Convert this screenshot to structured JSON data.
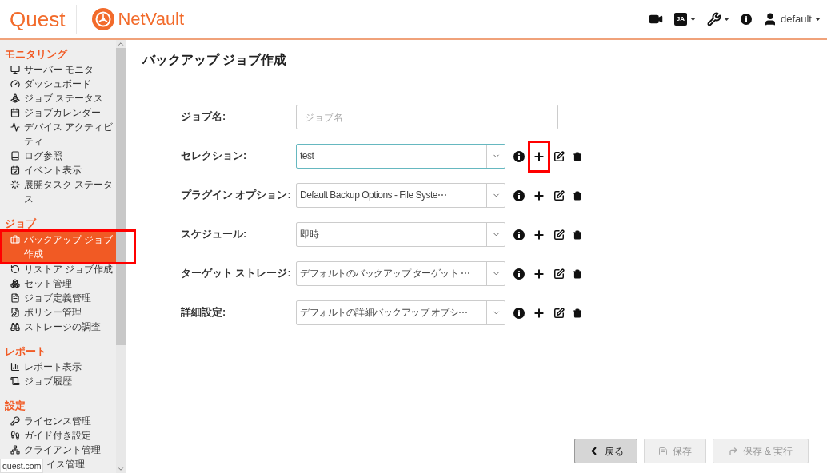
{
  "header": {
    "brand": "Quest",
    "product": "NetVault",
    "language": "JA",
    "user": "default"
  },
  "sidebar": {
    "sections": [
      {
        "title": "モニタリング",
        "items": [
          {
            "label": "サーバー モニタ",
            "selected": false
          },
          {
            "label": "ダッシュボード",
            "selected": false
          },
          {
            "label": "ジョブ ステータス",
            "selected": false
          },
          {
            "label": "ジョブカレンダー",
            "selected": false
          },
          {
            "label": "デバイス アクティビティ",
            "selected": false
          },
          {
            "label": "ログ参照",
            "selected": false
          },
          {
            "label": "イベント表示",
            "selected": false
          },
          {
            "label": "展開タスク ステータス",
            "selected": false
          }
        ]
      },
      {
        "title": "ジョブ",
        "items": [
          {
            "label": "バックアップ ジョブ作成",
            "selected": true,
            "highlighted": true
          },
          {
            "label": "リストア ジョブ作成",
            "selected": false
          },
          {
            "label": "セット管理",
            "selected": false
          },
          {
            "label": "ジョブ定義管理",
            "selected": false
          },
          {
            "label": "ポリシー管理",
            "selected": false
          },
          {
            "label": "ストレージの調査",
            "selected": false
          }
        ]
      },
      {
        "title": "レポート",
        "items": [
          {
            "label": "レポート表示",
            "selected": false
          },
          {
            "label": "ジョブ履歴",
            "selected": false
          }
        ]
      },
      {
        "title": "設定",
        "items": [
          {
            "label": "ライセンス管理",
            "selected": false
          },
          {
            "label": "ガイド付き設定",
            "selected": false
          },
          {
            "label": "クライアント管理",
            "selected": false
          },
          {
            "label": "イス管理",
            "selected": false,
            "covered": true
          }
        ]
      }
    ]
  },
  "status_tip": "quest.com",
  "page": {
    "title": "バックアップ ジョブ作成",
    "fields": [
      {
        "kind": "text",
        "label": "ジョブ名:",
        "placeholder": "ジョブ名"
      },
      {
        "kind": "select",
        "label": "セレクション:",
        "value": "test",
        "focused": true,
        "highlighted": true
      },
      {
        "kind": "select",
        "label": "プラグイン オプション:",
        "value": "Default Backup Options - File Syste⋯",
        "focused": false
      },
      {
        "kind": "select",
        "label": "スケジュール:",
        "value": "即時",
        "focused": false
      },
      {
        "kind": "select",
        "label": "ターゲット ストレージ:",
        "value": "デフォルトのバックアップ ターゲット ⋯",
        "focused": false
      },
      {
        "kind": "select",
        "label": "詳細設定:",
        "value": "デフォルトの詳細バックアップ オプシ⋯",
        "focused": false
      }
    ]
  },
  "buttons": [
    {
      "kind": "back",
      "label": "戻る",
      "disabled": false
    },
    {
      "kind": "save",
      "label": "保存",
      "disabled": true
    },
    {
      "kind": "run",
      "label": "保存 & 実行",
      "disabled": true
    }
  ]
}
